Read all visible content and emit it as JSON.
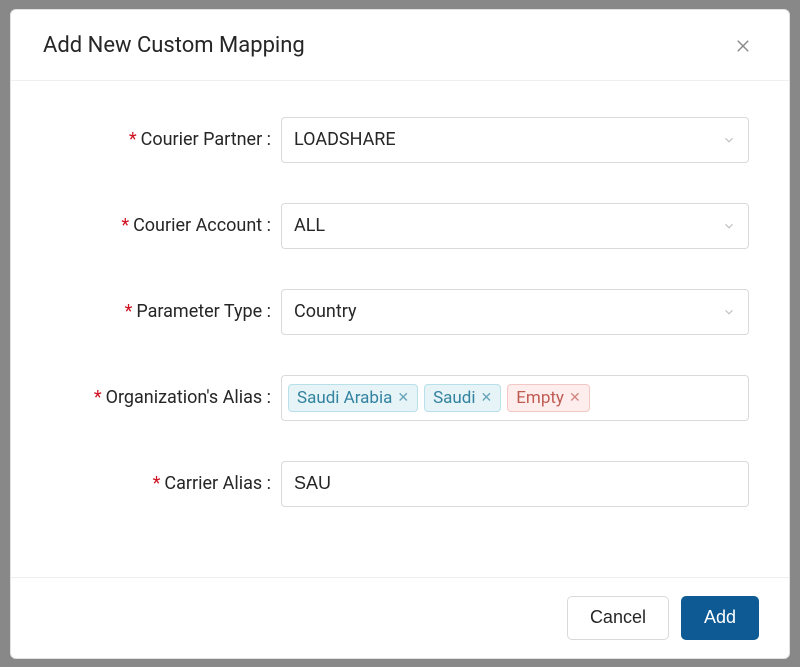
{
  "modal": {
    "title": "Add New Custom Mapping"
  },
  "form": {
    "courierPartner": {
      "label": "Courier Partner",
      "value": "LOADSHARE"
    },
    "courierAccount": {
      "label": "Courier Account",
      "value": "ALL"
    },
    "parameterType": {
      "label": "Parameter Type",
      "value": "Country"
    },
    "orgAlias": {
      "label": "Organization's Alias",
      "tags": [
        {
          "text": "Saudi Arabia",
          "variant": "blue"
        },
        {
          "text": "Saudi",
          "variant": "blue"
        },
        {
          "text": "Empty",
          "variant": "red"
        }
      ]
    },
    "carrierAlias": {
      "label": "Carrier Alias",
      "value": "SAU"
    }
  },
  "footer": {
    "cancel": "Cancel",
    "submit": "Add"
  }
}
